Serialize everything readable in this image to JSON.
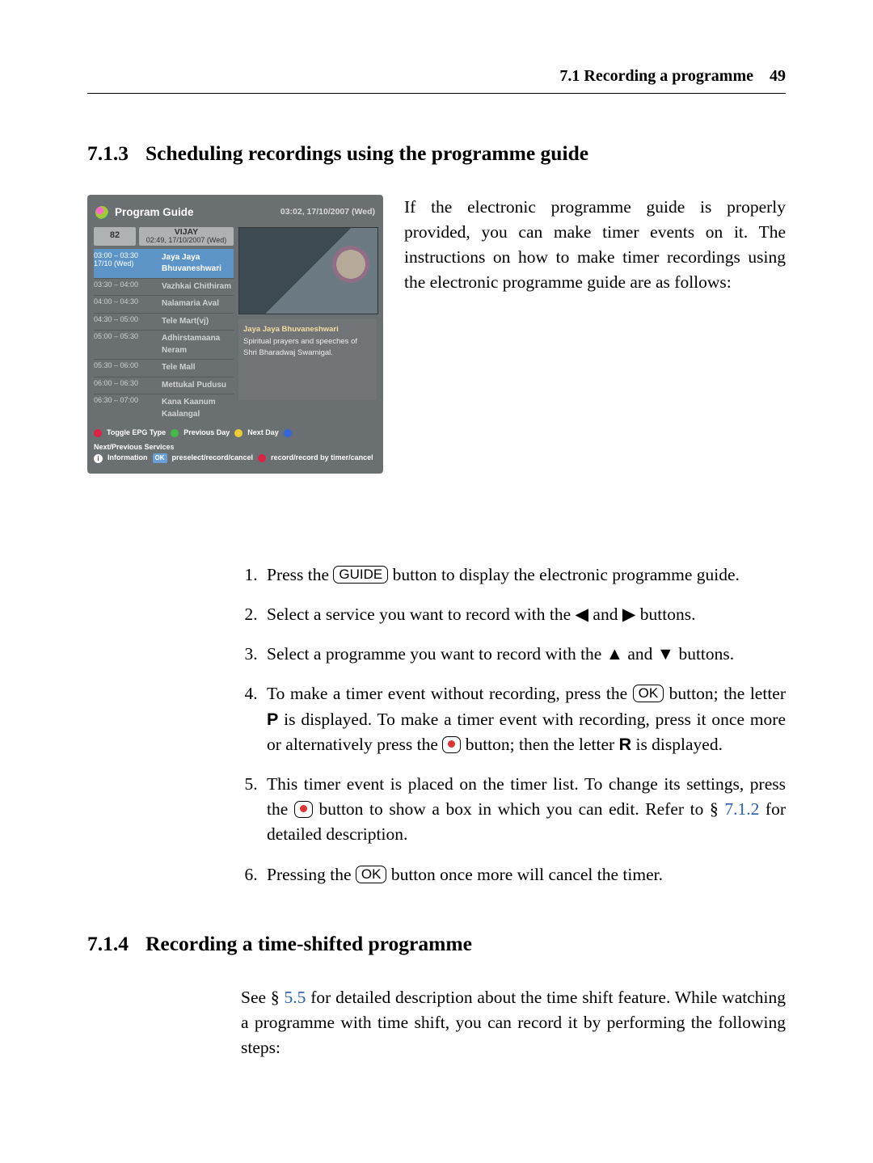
{
  "header": {
    "section": "7.1 Recording a programme",
    "page_number": "49"
  },
  "h713": {
    "num": "7.1.3",
    "title": "Scheduling recordings using the programme guide"
  },
  "intro_para": "If the electronic programme guide is properly provided, you can make timer events on it. The instructions on how to make timer recordings using the electronic programme guide are as follows:",
  "steps": {
    "s1a": "Press the ",
    "guide_btn": "GUIDE",
    "s1b": " button to display the electronic programme guide.",
    "s2a": "Select a service you want to record with the ",
    "left_arrow": "◀",
    "and1": " and ",
    "right_arrow": "▶",
    "s2b": " buttons.",
    "s3a": "Select a programme you want to record with the ",
    "up_arrow": "▲",
    "and2": " and ",
    "down_arrow": "▼",
    "s3b": " buttons.",
    "s4a": "To make a timer event without recording, press the ",
    "ok_btn": "OK",
    "s4b": " button; the letter ",
    "letter_p": "P",
    "s4c": " is displayed. To make a timer event with recording, press it once more or alternatively press the ",
    "s4d": " button; then the letter ",
    "letter_r": "R",
    "s4e": " is displayed.",
    "s5a": "This timer event is placed on the timer list. To change its settings, press the ",
    "s5b": " button to show a box in which you can edit. Refer to § ",
    "xref_712": "7.1.2",
    "s5c": " for detailed description.",
    "s6a": "Pressing the ",
    "s6b": " button once more will cancel the timer."
  },
  "h714": {
    "num": "7.1.4",
    "title": "Recording a time-shifted programme"
  },
  "p714a": "See § ",
  "xref_55": "5.5",
  "p714b": " for detailed description about the time shift feature. While watching a programme with time shift, you can record it by performing the following steps:",
  "epg": {
    "title": "Program Guide",
    "clock": "03:02, 17/10/2007 (Wed)",
    "channel_number": "82",
    "channel_name": "VIJAY",
    "channel_time": "02:49, 17/10/2007 (Wed)",
    "rows": [
      {
        "time": "03:00 – 03:30",
        "sub": "17/10 (Wed)",
        "name": "Jaya Jaya Bhuvaneshwari",
        "hl": true
      },
      {
        "time": "03:30 – 04:00",
        "sub": "",
        "name": "Vazhkai Chithiram",
        "hl": false
      },
      {
        "time": "04:00 – 04:30",
        "sub": "",
        "name": "Nalamaria Aval",
        "hl": false
      },
      {
        "time": "04:30 – 05:00",
        "sub": "",
        "name": "Tele Mart(vj)",
        "hl": false
      },
      {
        "time": "05:00 – 05:30",
        "sub": "",
        "name": "Adhirstamaana Neram",
        "hl": false
      },
      {
        "time": "05:30 – 06:00",
        "sub": "",
        "name": "Tele Mall",
        "hl": false
      },
      {
        "time": "06:00 – 06:30",
        "sub": "",
        "name": "Mettukal Pudusu",
        "hl": false
      },
      {
        "time": "06:30 – 07:00",
        "sub": "",
        "name": "Kana Kaanum Kaalangal",
        "hl": false
      }
    ],
    "detail_title": "Jaya Jaya Bhuvaneshwari",
    "detail_text": "Spiritual prayers and speeches of Shri Bharadwaj Swamigal.",
    "legend": {
      "l1": "Toggle EPG Type",
      "l2": "Previous Day",
      "l3": "Next Day",
      "l4": "Next/Previous Services",
      "l5": "Information",
      "l6": "OK",
      "l7": "preselect/record/cancel",
      "l8": "record/record by timer/cancel"
    }
  }
}
